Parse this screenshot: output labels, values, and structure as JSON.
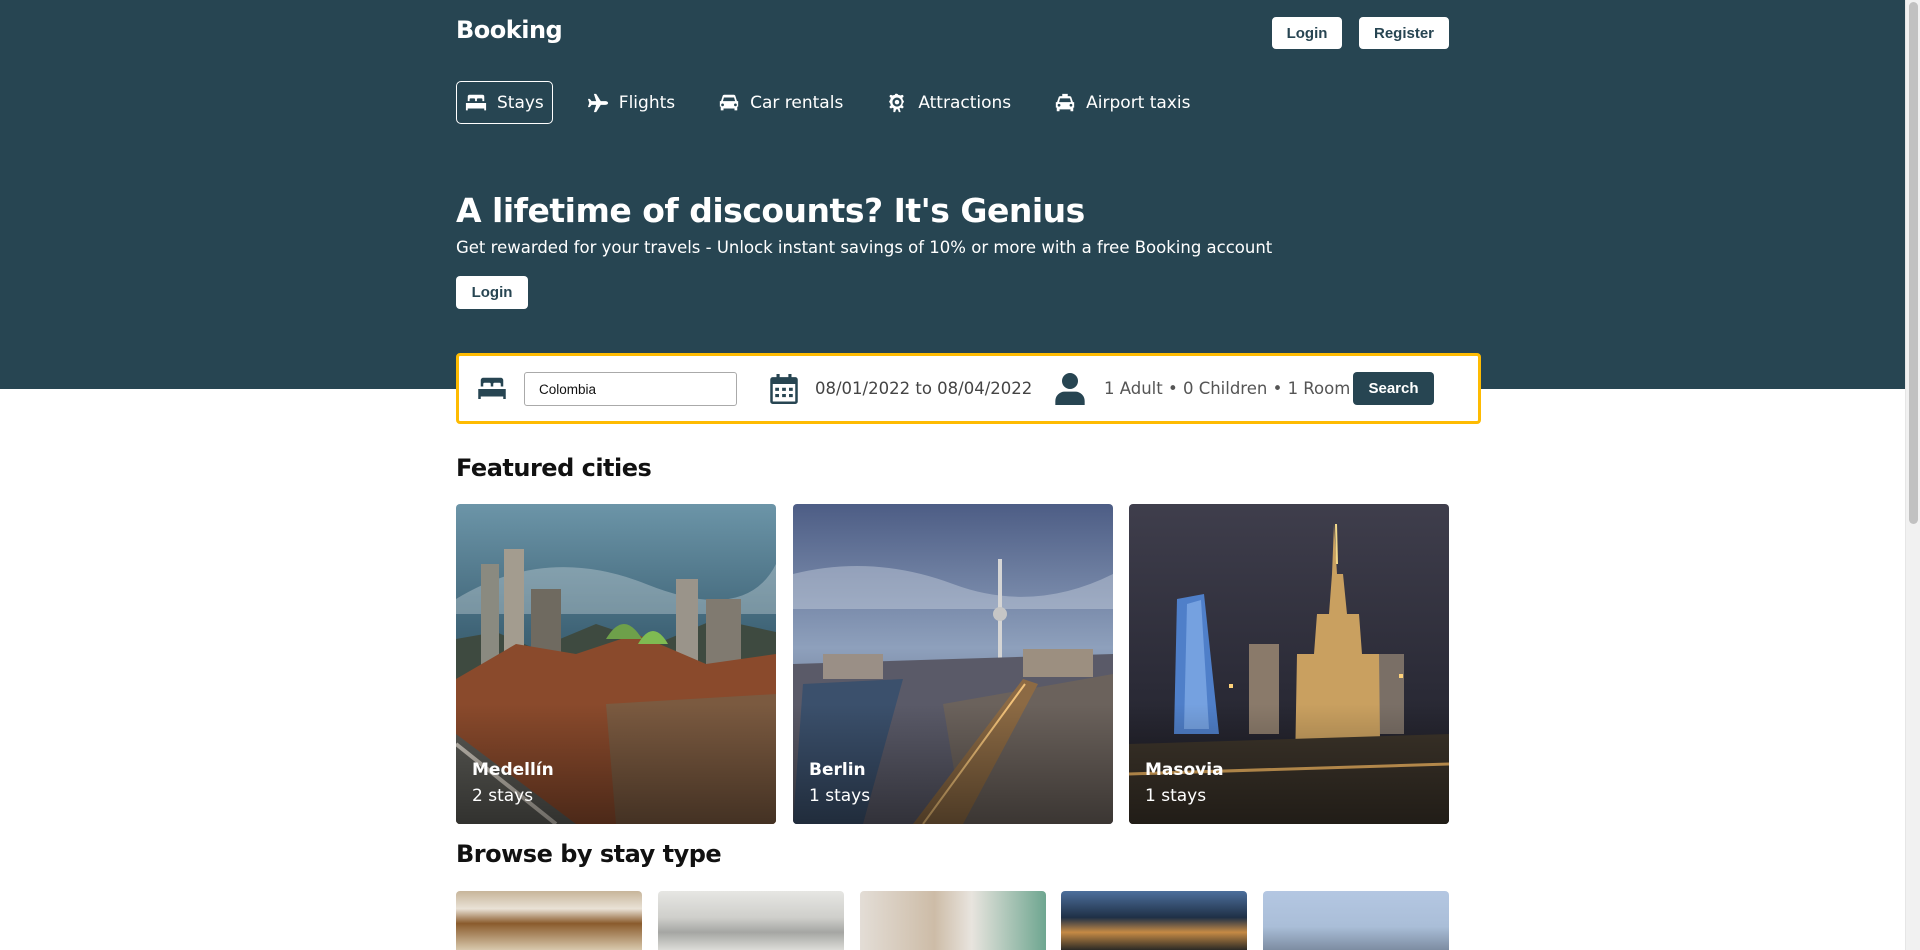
{
  "header": {
    "brand": "Booking",
    "login_label": "Login",
    "register_label": "Register"
  },
  "nav": {
    "items": [
      {
        "label": "Stays",
        "icon": "bed-icon",
        "active": true
      },
      {
        "label": "Flights",
        "icon": "plane-icon"
      },
      {
        "label": "Car rentals",
        "icon": "car-icon"
      },
      {
        "label": "Attractions",
        "icon": "ferris-wheel-icon"
      },
      {
        "label": "Airport taxis",
        "icon": "taxi-icon"
      }
    ]
  },
  "hero": {
    "title": "A lifetime of discounts? It's Genius",
    "subtitle": "Get rewarded for your travels - Unlock instant savings of 10% or more with a free Booking account",
    "login_label": "Login"
  },
  "search": {
    "destination_value": "Colombia",
    "dates": "08/01/2022 to 08/04/2022",
    "guests": "1 Adult • 0 Children • 1 Room",
    "button_label": "Search"
  },
  "featured": {
    "title": "Featured cities",
    "cities": [
      {
        "name": "Medellín",
        "stays": "2 stays"
      },
      {
        "name": "Berlin",
        "stays": "1 stays"
      },
      {
        "name": "Masovia",
        "stays": "1 stays"
      }
    ]
  },
  "browse": {
    "title": "Browse by stay type"
  },
  "colors": {
    "brand_dark": "#274552",
    "search_border": "#febb02",
    "white": "#ffffff"
  }
}
